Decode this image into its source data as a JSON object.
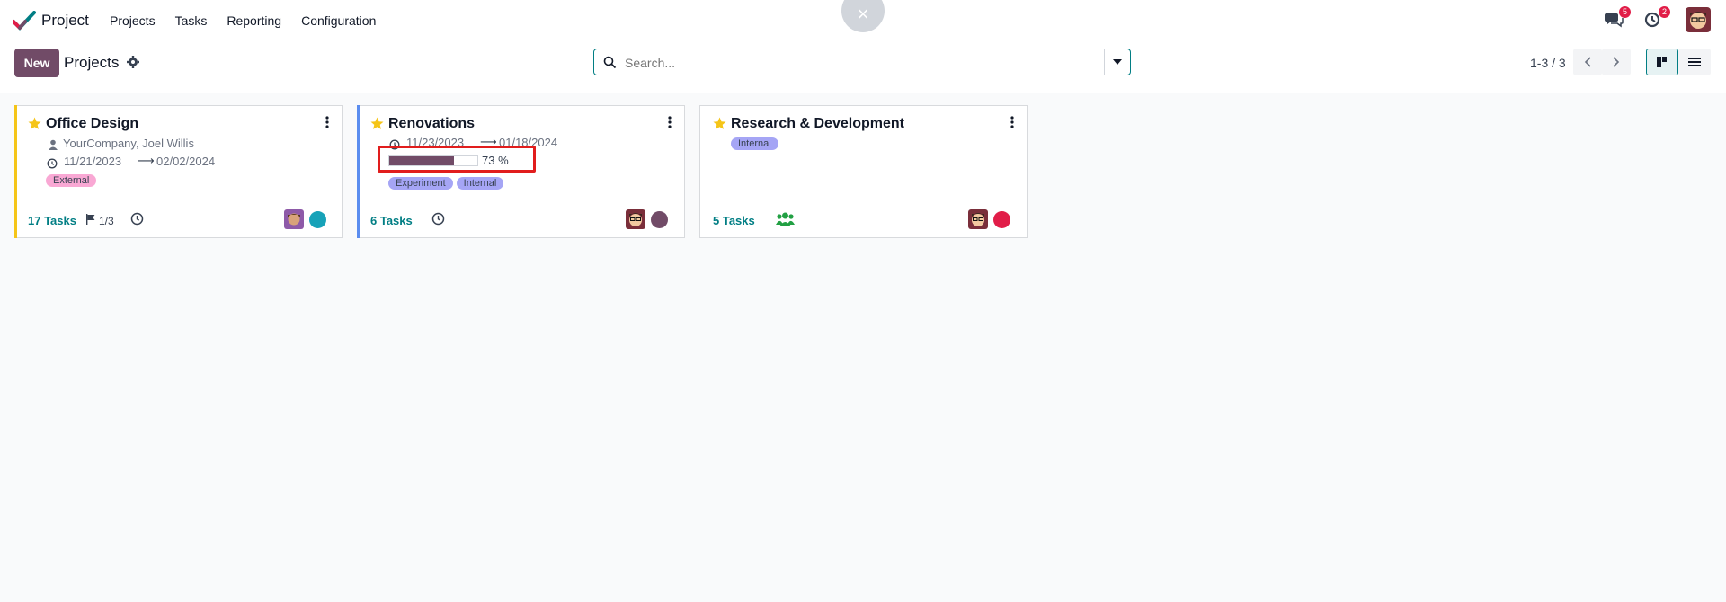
{
  "navbar": {
    "app_name": "Project",
    "menu": [
      "Projects",
      "Tasks",
      "Reporting",
      "Configuration"
    ],
    "close_symbol": "×",
    "messages_badge": "5",
    "activities_badge": "2"
  },
  "control": {
    "new_label": "New",
    "title": "Projects",
    "search_placeholder": "Search...",
    "pager": "1-3 / 3"
  },
  "cards": [
    {
      "title": "Office Design",
      "customer": "YourCompany, Joel Willis",
      "date_start": "11/21/2023",
      "date_end": "02/02/2024",
      "arrow": "⟶",
      "tags": [
        "External"
      ],
      "tasks": "17 Tasks",
      "milestones": "1/3",
      "accent_color": "#f5c518",
      "status_color": "#17a2b8"
    },
    {
      "title": "Renovations",
      "date_start": "11/23/2023",
      "date_end": "01/18/2024",
      "arrow": "⟶",
      "progress_percent": 73,
      "progress_label": "73 %",
      "tags": [
        "Experiment",
        "Internal"
      ],
      "tasks": "6 Tasks",
      "accent_color": "#5b8def",
      "status_color": "#714b67"
    },
    {
      "title": "Research & Development",
      "tags": [
        "Internal"
      ],
      "tasks": "5 Tasks",
      "status_color": "#e11d48"
    }
  ]
}
